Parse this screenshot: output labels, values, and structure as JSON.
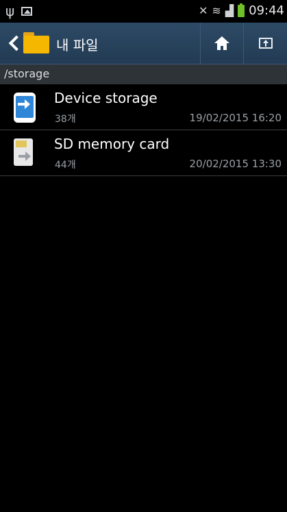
{
  "status_bar": {
    "time": "09:44",
    "icons": [
      "usb-icon",
      "gallery-icon",
      "mute-icon",
      "wifi-icon",
      "signal-icon",
      "battery-charging-icon"
    ]
  },
  "action_bar": {
    "title": "내 파일",
    "icons": [
      "back-icon",
      "folder-icon",
      "home-icon",
      "up-folder-icon"
    ]
  },
  "path": "/storage",
  "items": [
    {
      "name": "Device storage",
      "count": "38개",
      "date": "19/02/2015 16:20",
      "icon": "phone-storage-icon"
    },
    {
      "name": "SD memory card",
      "count": "44개",
      "date": "20/02/2015 13:30",
      "icon": "sd-card-icon"
    }
  ],
  "colors": {
    "action_bar": "#2a4560",
    "path_bar": "#2e3338",
    "folder": "#f5b700",
    "phone_screen": "#2f86d6"
  }
}
